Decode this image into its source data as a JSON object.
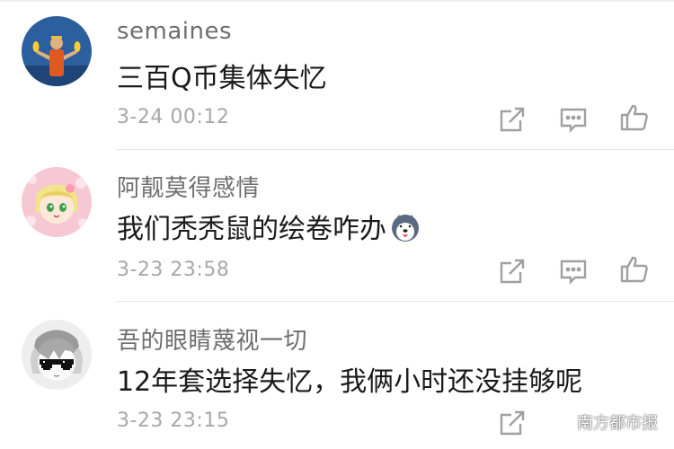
{
  "comments": [
    {
      "username": "semaines",
      "text": "三百Q币集体失忆",
      "time": "3-24 00:12",
      "avatar": "buddha-avatar"
    },
    {
      "username": "阿靓莫得感情",
      "text": "我们秃秃鼠的绘卷咋办",
      "time": "3-23 23:58",
      "avatar": "anime-girl-avatar",
      "emoji": "husky-emoji"
    },
    {
      "username": "吾的眼睛蔑视一切",
      "text": "12年套选择失忆，我俩小时还没挂够呢",
      "time": "3-23 23:15",
      "avatar": "sunglasses-avatar"
    }
  ],
  "actions": [
    "share-icon",
    "reply-icon",
    "like-icon"
  ],
  "watermark": "南方都市报",
  "colors": {
    "username": "#6e6e6e",
    "text": "#1a1a1a",
    "time": "#a8a8a8",
    "icon": "#a0a0a0"
  }
}
